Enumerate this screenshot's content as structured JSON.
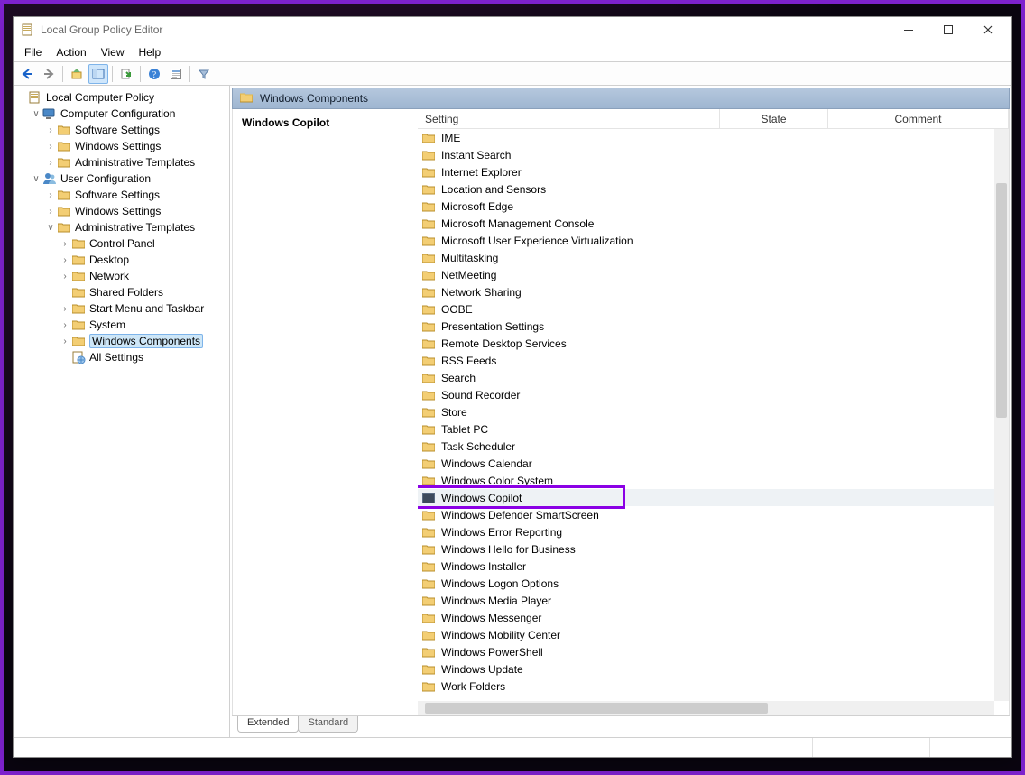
{
  "window": {
    "title": "Local Group Policy Editor"
  },
  "menubar": {
    "items": [
      "File",
      "Action",
      "View",
      "Help"
    ]
  },
  "tree": {
    "root": "Local Computer Policy",
    "computer": {
      "label": "Computer Configuration",
      "children": [
        "Software Settings",
        "Windows Settings",
        "Administrative Templates"
      ]
    },
    "user": {
      "label": "User Configuration",
      "children": [
        "Software Settings",
        "Windows Settings"
      ],
      "admin": {
        "label": "Administrative Templates",
        "children": [
          "Control Panel",
          "Desktop",
          "Network",
          "Shared Folders",
          "Start Menu and Taskbar",
          "System",
          "Windows Components",
          "All Settings"
        ],
        "selected": "Windows Components"
      }
    }
  },
  "content": {
    "header": "Windows Components",
    "left_title": "Windows Copilot",
    "columns": {
      "setting": "Setting",
      "state": "State",
      "comment": "Comment"
    },
    "selected": "Windows Copilot",
    "items": [
      "IME",
      "Instant Search",
      "Internet Explorer",
      "Location and Sensors",
      "Microsoft Edge",
      "Microsoft Management Console",
      "Microsoft User Experience Virtualization",
      "Multitasking",
      "NetMeeting",
      "Network Sharing",
      "OOBE",
      "Presentation Settings",
      "Remote Desktop Services",
      "RSS Feeds",
      "Search",
      "Sound Recorder",
      "Store",
      "Tablet PC",
      "Task Scheduler",
      "Windows Calendar",
      "Windows Color System",
      "Windows Copilot",
      "Windows Defender SmartScreen",
      "Windows Error Reporting",
      "Windows Hello for Business",
      "Windows Installer",
      "Windows Logon Options",
      "Windows Media Player",
      "Windows Messenger",
      "Windows Mobility Center",
      "Windows PowerShell",
      "Windows Update",
      "Work Folders"
    ],
    "tabs": [
      "Extended",
      "Standard"
    ],
    "active_tab": "Extended"
  }
}
